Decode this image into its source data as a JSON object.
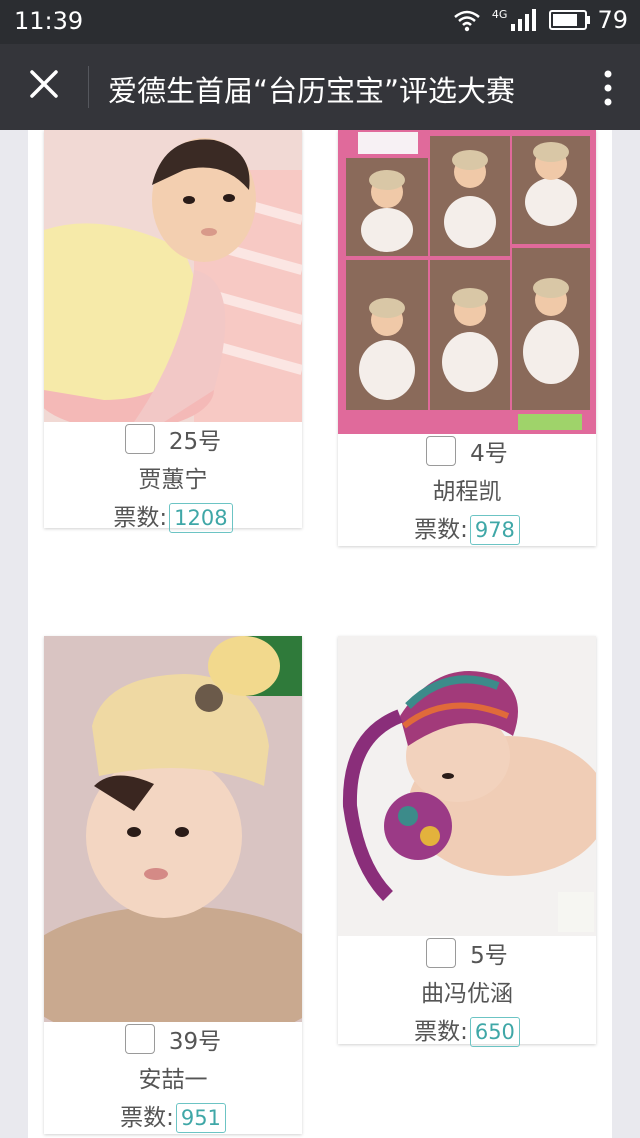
{
  "status": {
    "time": "11:39",
    "network": "4G",
    "battery": "79"
  },
  "nav": {
    "title": "爱德生首届“台历宝宝”评选大赛"
  },
  "entries": [
    {
      "number": "25号",
      "name": "贾蕙宁",
      "votes_label": "票数:",
      "votes": "1208"
    },
    {
      "number": "4号",
      "name": "胡程凯",
      "votes_label": "票数:",
      "votes": "978"
    },
    {
      "number": "39号",
      "name": "安喆一",
      "votes_label": "票数:",
      "votes": "951"
    },
    {
      "number": "5号",
      "name": "曲冯优涵",
      "votes_label": "票数:",
      "votes": "650"
    }
  ],
  "colors": {
    "nav_bg": "#34353a",
    "status_bg": "#2b2d31",
    "accent": "#3fa7a7"
  }
}
